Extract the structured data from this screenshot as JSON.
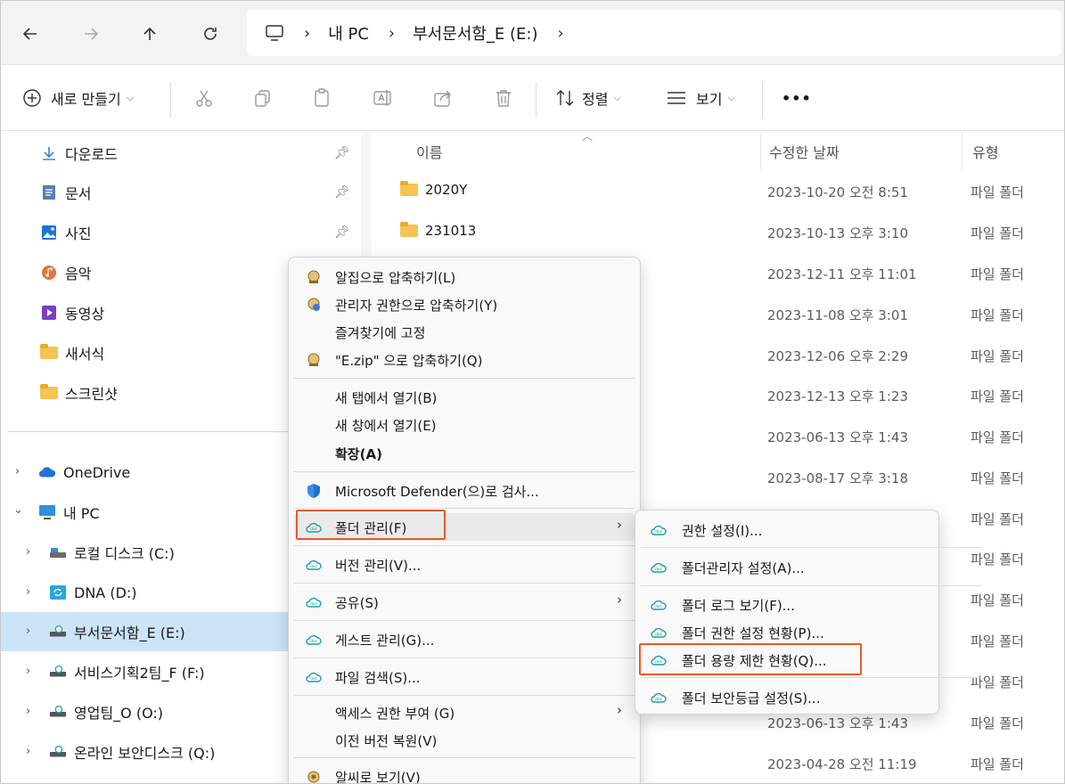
{
  "address": {
    "crumbs": [
      "내 PC",
      "부서문서함_E (E:)"
    ]
  },
  "toolbar": {
    "new_label": "새로 만들기",
    "sort_label": "정렬",
    "view_label": "보기",
    "more_label": "•••"
  },
  "sidebar": {
    "quick": [
      {
        "label": "다운로드",
        "icon": "download-icon"
      },
      {
        "label": "문서",
        "icon": "document-icon"
      },
      {
        "label": "사진",
        "icon": "pictures-icon"
      },
      {
        "label": "음악",
        "icon": "music-icon"
      },
      {
        "label": "동영상",
        "icon": "video-icon"
      },
      {
        "label": "새서식",
        "icon": "folder-icon"
      },
      {
        "label": "스크린샷",
        "icon": "folder-icon"
      }
    ],
    "tree": [
      {
        "label": "OneDrive"
      },
      {
        "label": "내 PC"
      },
      {
        "label": "로컬 디스크 (C:)"
      },
      {
        "label": "DNA (D:)"
      },
      {
        "label": "부서문서함_E (E:)"
      },
      {
        "label": "서비스기획2팀_F (F:)"
      },
      {
        "label": "영업팀_O (O:)"
      },
      {
        "label": "온라인 보안디스크 (Q:)"
      }
    ]
  },
  "filelist": {
    "headers": {
      "name": "이름",
      "date": "수정한 날짜",
      "type": "유형"
    },
    "rows": [
      {
        "name": "2020Y",
        "date": "2023-10-20 오전 8:51",
        "type": "파일 폴더"
      },
      {
        "name": "231013",
        "date": "2023-10-13 오후 3:10",
        "type": "파일 폴더"
      },
      {
        "name": "",
        "date": "2023-12-11 오후 11:01",
        "type": "파일 폴더"
      },
      {
        "name": "",
        "date": "2023-11-08 오후 3:01",
        "type": "파일 폴더"
      },
      {
        "name": "",
        "date": "2023-12-06 오후 2:29",
        "type": "파일 폴더"
      },
      {
        "name": "",
        "date": "2023-12-13 오후 1:23",
        "type": "파일 폴더"
      },
      {
        "name": "",
        "date": "2023-06-13 오후 1:43",
        "type": "파일 폴더"
      },
      {
        "name": "",
        "date": "2023-08-17 오후 3:18",
        "type": "파일 폴더"
      },
      {
        "name": "",
        "date": "",
        "type": "파일 폴더"
      },
      {
        "name": "",
        "date": "",
        "type": "파일 폴더"
      },
      {
        "name": "",
        "date": "",
        "type": "파일 폴더"
      },
      {
        "name": "",
        "date": "",
        "type": "파일 폴더"
      },
      {
        "name": "",
        "date": "",
        "type": "파일 폴더"
      },
      {
        "name": "",
        "date": "2023-06-13 오후 1:43",
        "type": "파일 폴더"
      },
      {
        "name": "",
        "date": "2023-04-28 오전 11:19",
        "type": "파일 폴더"
      }
    ]
  },
  "context_menu": {
    "items": [
      {
        "label": "알집으로 압축하기(L)",
        "icon": "alzip-icon"
      },
      {
        "label": "관리자 권한으로 압축하기(Y)",
        "icon": "alzip-admin-icon"
      },
      {
        "label": "즐겨찾기에 고정",
        "icon": ""
      },
      {
        "label": "\"E.zip\" 으로 압축하기(Q)",
        "icon": "alzip-icon"
      },
      {
        "label": "새 탭에서 열기(B)",
        "icon": ""
      },
      {
        "label": "새 창에서 열기(E)",
        "icon": ""
      },
      {
        "label": "확장(A)",
        "icon": ""
      },
      {
        "label": "Microsoft Defender(으)로 검사...",
        "icon": "defender-icon"
      },
      {
        "label": "폴더 관리(F)",
        "icon": "doc-icon"
      },
      {
        "label": "버전 관리(V)...",
        "icon": "doc-icon"
      },
      {
        "label": "공유(S)",
        "icon": "doc-icon"
      },
      {
        "label": "게스트 관리(G)...",
        "icon": "doc-icon"
      },
      {
        "label": "파일 검색(S)...",
        "icon": "doc-icon"
      },
      {
        "label": "액세스 권한 부여 (G)",
        "icon": ""
      },
      {
        "label": "이전 버전 복원(V)",
        "icon": ""
      },
      {
        "label": "알씨로 보기(V)",
        "icon": "alsee-icon"
      }
    ]
  },
  "submenu": {
    "items": [
      {
        "label": "권한 설정(I)..."
      },
      {
        "label": "폴더관리자 설정(A)..."
      },
      {
        "label": "폴더 로그 보기(F)..."
      },
      {
        "label": "폴더 권한 설정 현황(P)..."
      },
      {
        "label": "폴더 용량 제한 현황(Q)..."
      },
      {
        "label": "폴더 보안등급 설정(S)..."
      }
    ]
  },
  "colors": {
    "highlight": "#e8582c",
    "selected_bg": "#cce4f7",
    "folder": "#f5c451",
    "accent": "#0067c0"
  }
}
